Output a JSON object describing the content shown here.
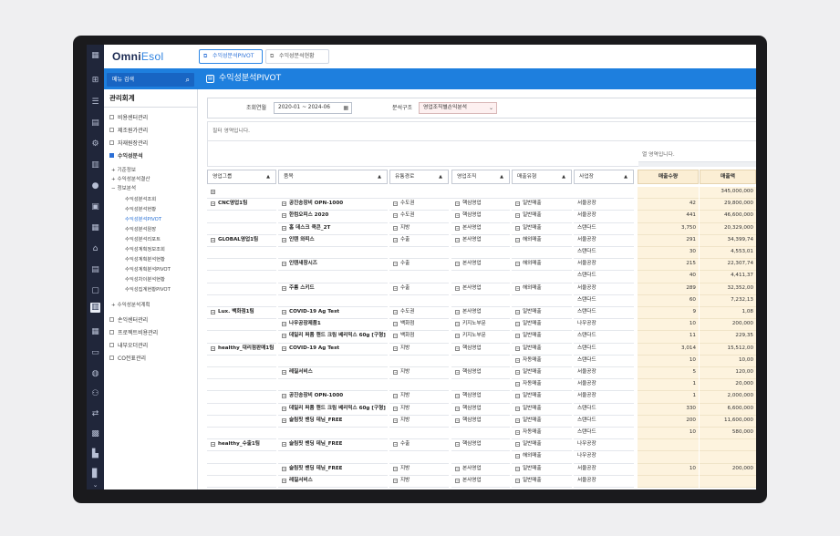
{
  "app": {
    "logo_prefix": "Omni",
    "logo_suffix": "Esol",
    "tabs": [
      "수익성분석PIVOT",
      "수익성분석현황"
    ],
    "menu_search_placeholder": "메뉴 검색",
    "page_title": "수익성분석PIVOT"
  },
  "sidebar": {
    "header": "관리회계",
    "items": [
      {
        "label": "비용센터관리",
        "open": false
      },
      {
        "label": "제조원가관리",
        "open": false
      },
      {
        "label": "자재원장관리",
        "open": false
      },
      {
        "label": "수익성분석",
        "open": true
      }
    ],
    "subgroups": [
      "기준정보",
      "수익성분석결산",
      "정보분석"
    ],
    "leaves": [
      "수익성분석조회",
      "수익성분석현황",
      "수익성분석PIVOT",
      "수익성분석원장",
      "수익성분석리포트",
      "수익성계획정보조회",
      "수익성계획분석현황",
      "수익성계획분석PIVOT",
      "수익성차이분석현황",
      "수익성집계현황PIVOT"
    ],
    "selected_leaf": "수익성분석PIVOT",
    "subgroup_after": "수익성분석계획",
    "bottom_items": [
      "손익센터관리",
      "프로젝트비용관리",
      "내부오더관리",
      "CO전표관리"
    ]
  },
  "filters": {
    "period_label": "조회연월",
    "period_value": "2020-01 ~ 2024-06",
    "structure_label": "분석구조",
    "structure_value": "영업조직별손익분석"
  },
  "pivot": {
    "filter_area_text": "필터 영역입니다.",
    "column_area_text": "열 영역입니다.",
    "row_headers": [
      "영업그룹",
      "품목",
      "유통경로",
      "영업조직",
      "매출유형",
      "사업장"
    ],
    "value_headers": [
      "매출수량",
      "매출액"
    ],
    "grand_total": {
      "sales_amount": "345,000,000"
    },
    "rows": [
      {
        "group": "CNC영업1팀",
        "item": "공진송장비 OPN-1000",
        "channel": "수도권",
        "org": "핵심영업",
        "type": "일반매출",
        "site": "서울공장",
        "qty": "42",
        "amt": "29,800,000"
      },
      {
        "group": "",
        "item": "한컴오피스 2020",
        "channel": "수도권",
        "org": "핵심영업",
        "type": "일반매출",
        "site": "서울공장",
        "qty": "441",
        "amt": "46,600,000"
      },
      {
        "group": "",
        "item": "홈 데스크 쿡콘_2T",
        "channel": "지방",
        "org": "본사영업",
        "type": "일반매출",
        "site": "스탠다드",
        "qty": "3,750",
        "amt": "20,329,000"
      },
      {
        "group": "GLOBAL영업1팀",
        "item": "인텐 와피스",
        "channel": "수출",
        "org": "본사영업",
        "type": "해외매출",
        "site": "서울공장",
        "qty": "291",
        "amt": "34,399,74"
      },
      {
        "group": "",
        "item": "",
        "channel": "",
        "org": "",
        "type": "",
        "site": "스탠다드",
        "qty": "30",
        "amt": "4,553,01"
      },
      {
        "group": "",
        "item": "인텐새창시즈",
        "channel": "수출",
        "org": "본사영업",
        "type": "해외매출",
        "site": "서울공장",
        "qty": "215",
        "amt": "22,307,74"
      },
      {
        "group": "",
        "item": "",
        "channel": "",
        "org": "",
        "type": "",
        "site": "스탠다드",
        "qty": "40",
        "amt": "4,411,37"
      },
      {
        "group": "",
        "item": "주름 스키드",
        "channel": "수출",
        "org": "본사영업",
        "type": "해외매출",
        "site": "서울공장",
        "qty": "289",
        "amt": "32,352,00"
      },
      {
        "group": "",
        "item": "",
        "channel": "",
        "org": "",
        "type": "",
        "site": "스탠다드",
        "qty": "60",
        "amt": "7,232,13"
      },
      {
        "group": "Lux. 백화점1팀",
        "item": "COVID-19 Ag Test",
        "channel": "수도권",
        "org": "본사영업",
        "type": "일반매출",
        "site": "스탠다드",
        "qty": "9",
        "amt": "1,08"
      },
      {
        "group": "",
        "item": "나우공장제품1",
        "channel": "백화점",
        "org": "키지노부문",
        "type": "일반매출",
        "site": "나우공장",
        "qty": "10",
        "amt": "200,000"
      },
      {
        "group": "",
        "item": "데일리 퍼퓸 핸드 크림 베리믹스 60g [구형]",
        "channel": "백화점",
        "org": "키지노부문",
        "type": "일반매출",
        "site": "스탠다드",
        "qty": "11",
        "amt": "229,35"
      },
      {
        "group": "healthy_대리점판매1팀",
        "item": "COVID-19 Ag Test",
        "channel": "지방",
        "org": "핵심영업",
        "type": "일반매출",
        "site": "스탠다드",
        "qty": "3,014",
        "amt": "15,512,00"
      },
      {
        "group": "",
        "item": "",
        "channel": "",
        "org": "",
        "type": "자동매출",
        "site": "스탠다드",
        "qty": "10",
        "amt": "10,00"
      },
      {
        "group": "",
        "item": "레질서비스",
        "channel": "지방",
        "org": "핵심영업",
        "type": "일반매출",
        "site": "서울공장",
        "qty": "5",
        "amt": "120,00"
      },
      {
        "group": "",
        "item": "",
        "channel": "",
        "org": "",
        "type": "자동매출",
        "site": "서울공장",
        "qty": "1",
        "amt": "20,000"
      },
      {
        "group": "",
        "item": "공진송장비 OPN-1000",
        "channel": "지방",
        "org": "핵심영업",
        "type": "일반매출",
        "site": "서울공장",
        "qty": "1",
        "amt": "2,000,000"
      },
      {
        "group": "",
        "item": "데일리 퍼퓸 핸드 크림 베리믹스 60g [구형]",
        "channel": "지방",
        "org": "핵심영업",
        "type": "일반매출",
        "site": "스탠다드",
        "qty": "330",
        "amt": "6,600,000"
      },
      {
        "group": "",
        "item": "슬림핏 밴딩 데님_FREE",
        "channel": "지방",
        "org": "핵심영업",
        "type": "일반매출",
        "site": "스탠다드",
        "qty": "200",
        "amt": "11,600,000"
      },
      {
        "group": "",
        "item": "",
        "channel": "",
        "org": "",
        "type": "자동매출",
        "site": "스탠다드",
        "qty": "10",
        "amt": "580,000"
      },
      {
        "group": "healthy_수출1팀",
        "item": "슬림핏 밴딩 데님_FREE",
        "channel": "수출",
        "org": "핵심영업",
        "type": "일반매출",
        "site": "나우공장",
        "qty": "",
        "amt": ""
      },
      {
        "group": "",
        "item": "",
        "channel": "",
        "org": "",
        "type": "해외매출",
        "site": "나우공장",
        "qty": "",
        "amt": ""
      },
      {
        "group": "",
        "item": "슬림핏 밴딩 데님_FREE",
        "channel": "지방",
        "org": "본사영업",
        "type": "일반매출",
        "site": "서울공장",
        "qty": "10",
        "amt": "200,000"
      },
      {
        "group": "",
        "item": "레질서비스",
        "channel": "지방",
        "org": "본사영업",
        "type": "일반매출",
        "site": "서울공장",
        "qty": "",
        "amt": ""
      }
    ]
  },
  "colors": {
    "brand_blue": "#1e7fde",
    "rail": "#20263a",
    "value_bg": "#fdf3de"
  }
}
